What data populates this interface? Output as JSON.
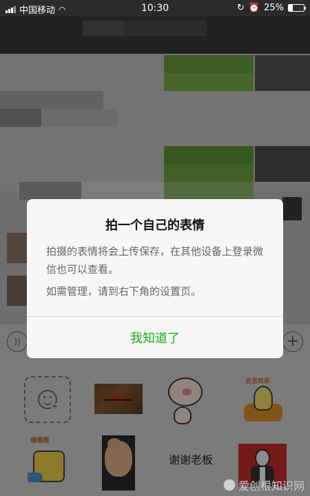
{
  "status_bar": {
    "carrier": "中国移动",
    "time": "10:30",
    "battery_percent": "25%",
    "battery_level": 0.25,
    "icons": [
      "signal-icon",
      "wifi-icon",
      "rotation-lock-icon",
      "alarm-icon",
      "battery-icon"
    ]
  },
  "dialog": {
    "title": "拍一个自己的表情",
    "message_line1": "拍摄的表情将会上传保存，在其他设备上登录微信也可以查看。",
    "message_line2": "如需管理，请到右下角的设置页。",
    "confirm_label": "我知道了",
    "confirm_color": "#1aad19"
  },
  "stickers": {
    "dino_caption": "吉吉欢乐",
    "cheese_caption": "嘀嘀嘀",
    "text_sticker": "谢谢老板"
  },
  "watermark": {
    "text": "爱创根知识网"
  }
}
